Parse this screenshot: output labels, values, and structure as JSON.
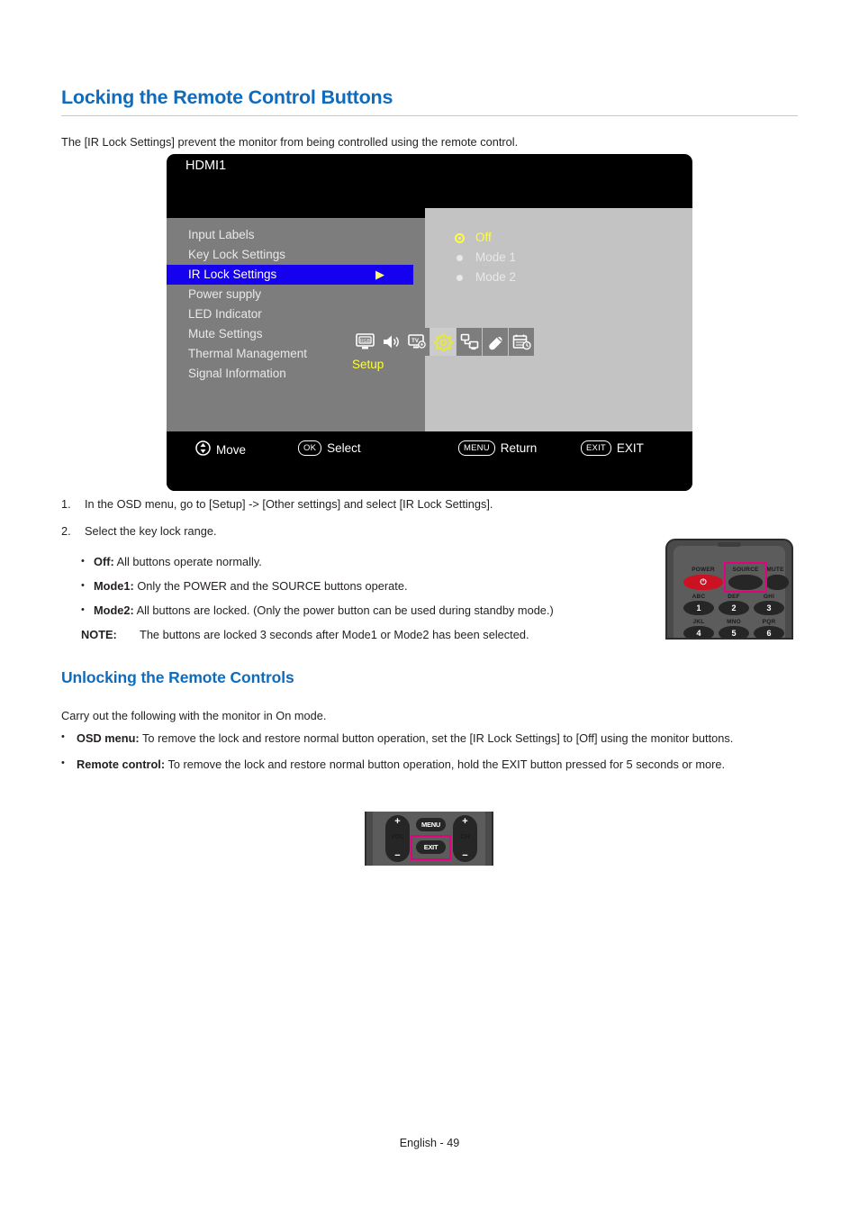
{
  "page": {
    "heading": "Locking the Remote Control Buttons",
    "intro": "The [IR Lock Settings] prevent the monitor from being controlled using the remote control.",
    "sub_heading": "Unlocking the Remote Controls",
    "carry_text": "Carry out the following with the monitor in On mode.",
    "footer": "English - 49",
    "accent_color": "#0f6cbd",
    "highlight_color": "#e6007e"
  },
  "steps": [
    {
      "marker": "1.",
      "text": "In the OSD menu, go to [Setup] -> [Other settings] and select [IR Lock Settings]."
    },
    {
      "marker": "2.",
      "text": "Select the key lock range."
    }
  ],
  "mode_bullets": [
    {
      "bullet": "•",
      "label": "Off:",
      "text": " All buttons operate normally."
    },
    {
      "bullet": "•",
      "label": "Mode1:",
      "text": " Only the POWER and the SOURCE buttons operate."
    },
    {
      "bullet": "•",
      "label": "Mode2:",
      "text": " All buttons are locked. (Only the power button can be used during standby mode.)"
    }
  ],
  "note": {
    "label": "NOTE:",
    "text": "The buttons are locked 3 seconds after Mode1 or Mode2 has been selected."
  },
  "unlock_bullets": [
    {
      "bullet": "•",
      "label": "OSD menu:",
      "text": " To remove the lock and restore normal button operation, set the [IR Lock Settings] to [Off] using the monitor buttons."
    },
    {
      "bullet": "•",
      "label": "Remote control:",
      "text": " To remove the lock and restore normal button operation, hold the EXIT button pressed for 5 seconds or more."
    }
  ],
  "osd": {
    "source_label": "HDMI1",
    "tab_name": "Setup",
    "icons": [
      {
        "name": "rgb-display-icon",
        "label": "RGB",
        "active": false
      },
      {
        "name": "speaker-icon",
        "label": "Audio",
        "active": false
      },
      {
        "name": "tv-settings-icon",
        "label": "Video",
        "active": false
      },
      {
        "name": "gear-icon",
        "label": "Setup",
        "active": true
      },
      {
        "name": "network-icon",
        "label": "Network",
        "active": false
      },
      {
        "name": "usb-icon",
        "label": "USB",
        "active": false
      },
      {
        "name": "schedule-icon",
        "label": "Schedule",
        "active": false
      }
    ],
    "menu_items": [
      {
        "label": "Input Labels",
        "selected": false,
        "arrow": ""
      },
      {
        "label": "Key Lock Settings",
        "selected": false,
        "arrow": ""
      },
      {
        "label": "IR Lock Settings",
        "selected": true,
        "arrow": "▶"
      },
      {
        "label": "Power supply",
        "selected": false,
        "arrow": ""
      },
      {
        "label": "LED Indicator",
        "selected": false,
        "arrow": ""
      },
      {
        "label": "Mute Settings",
        "selected": false,
        "arrow": ""
      },
      {
        "label": "Thermal Management",
        "selected": false,
        "arrow": ""
      },
      {
        "label": "Signal Information",
        "selected": false,
        "arrow": ""
      }
    ],
    "options": [
      {
        "label": "Off",
        "selected": true
      },
      {
        "label": "Mode 1",
        "selected": false
      },
      {
        "label": "Mode 2",
        "selected": false
      }
    ],
    "hints": [
      {
        "key": "",
        "icon": "updown-arrows-icon",
        "label": "Move"
      },
      {
        "key": "OK",
        "icon": "",
        "label": "Select"
      },
      {
        "key": "MENU",
        "icon": "",
        "label": "Return"
      },
      {
        "key": "EXIT",
        "icon": "",
        "label": "EXIT"
      }
    ]
  },
  "remote_top": {
    "row1": [
      {
        "name": "power-button",
        "label": "POWER",
        "glyph": "⏻",
        "style": "power"
      },
      {
        "name": "source-button",
        "label": "SOURCE",
        "glyph": "",
        "style": "dark",
        "highlighted": true
      },
      {
        "name": "mute-button",
        "label": "MUTE",
        "glyph": "",
        "style": "dark"
      }
    ],
    "row2": [
      {
        "name": "key-1",
        "sublabel": "ABC",
        "digit": "1"
      },
      {
        "name": "key-2",
        "sublabel": "DEF",
        "digit": "2"
      },
      {
        "name": "key-3",
        "sublabel": "GHI",
        "digit": "3"
      }
    ],
    "row3": [
      {
        "name": "key-4",
        "sublabel": "JKL",
        "digit": "4"
      },
      {
        "name": "key-5",
        "sublabel": "MNO",
        "digit": "5"
      },
      {
        "name": "key-6",
        "sublabel": "PQR",
        "digit": "6"
      }
    ]
  },
  "remote_bottom": {
    "vol": {
      "name": "volume-rocker",
      "label": "VOL",
      "plus": "+",
      "minus": "−"
    },
    "ch": {
      "name": "channel-rocker",
      "label": "CH",
      "plus": "+",
      "minus": "−"
    },
    "menu_button": {
      "name": "menu-button",
      "label": "MENU"
    },
    "exit_button": {
      "name": "exit-button",
      "label": "EXIT",
      "highlighted": true
    }
  }
}
